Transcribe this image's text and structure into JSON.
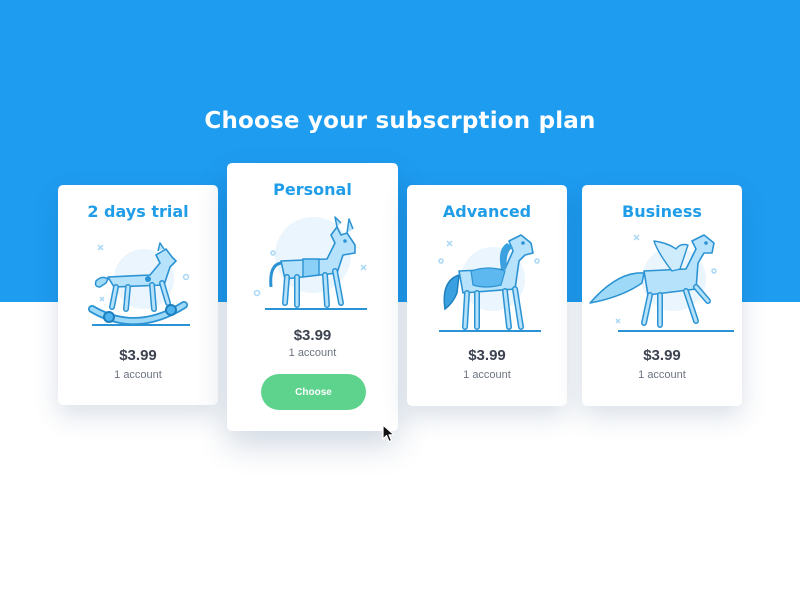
{
  "page": {
    "title": "Choose your subscrption plan"
  },
  "colors": {
    "accent": "#1e9cf0",
    "button": "#5ed38d",
    "title": "#1f9de8"
  },
  "plans": [
    {
      "name": "2 days trial",
      "price": "$3.99",
      "accounts": "1 account",
      "icon": "rocking-horse-icon"
    },
    {
      "name": "Personal",
      "price": "$3.99",
      "accounts": "1 account",
      "icon": "donkey-icon",
      "selected": true,
      "button_label": "Choose"
    },
    {
      "name": "Advanced",
      "price": "$3.99",
      "accounts": "1 account",
      "icon": "horse-icon"
    },
    {
      "name": "Business",
      "price": "$3.99",
      "accounts": "1 account",
      "icon": "pegasus-icon"
    }
  ]
}
